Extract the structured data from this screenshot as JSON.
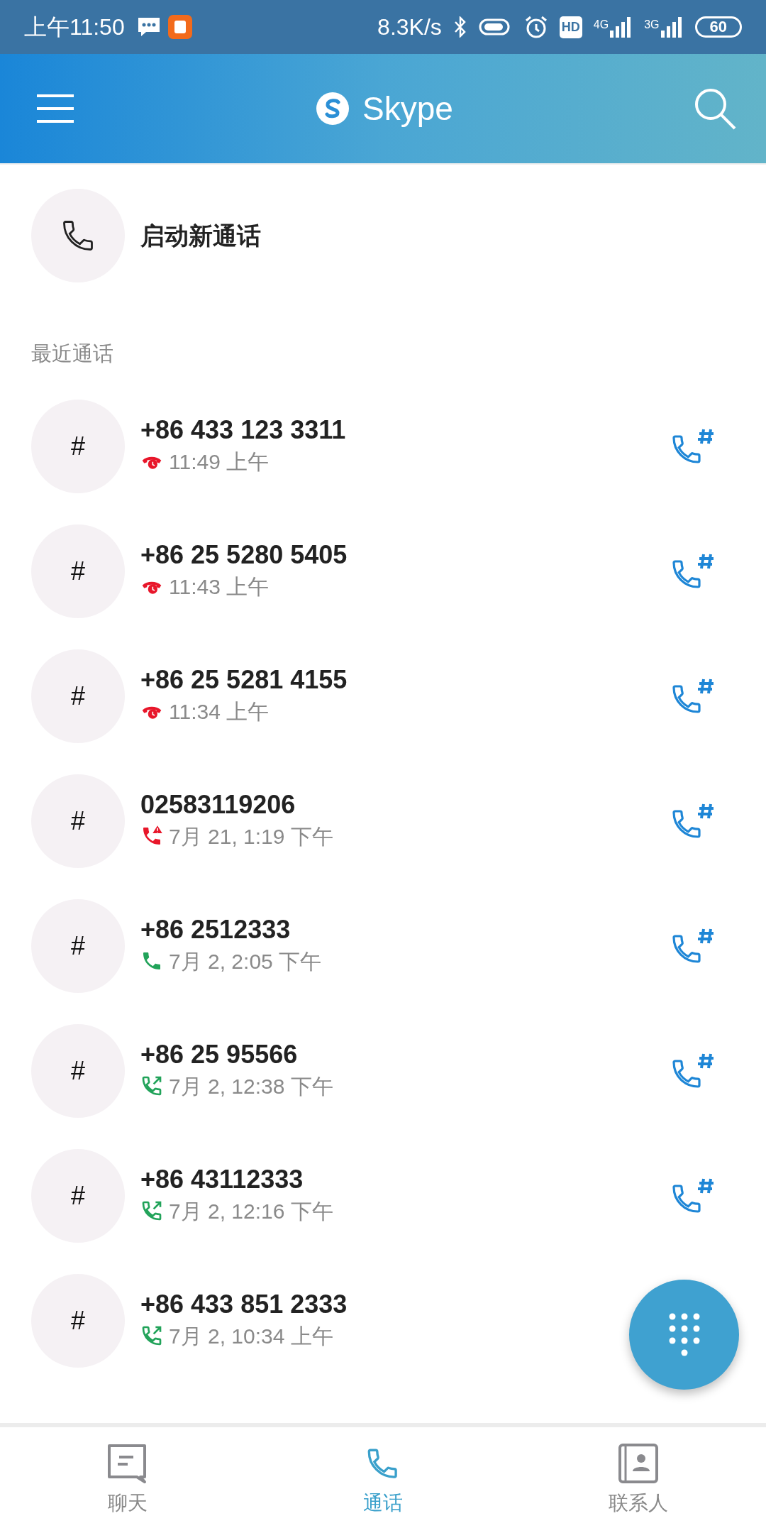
{
  "status_bar": {
    "time": "上午11:50",
    "speed": "8.3K/s",
    "hd": "HD",
    "net1": "4G",
    "net2": "3G",
    "battery": "60"
  },
  "header": {
    "title": "Skype"
  },
  "new_call": {
    "label": "启动新通话"
  },
  "section": "最近通话",
  "calls": [
    {
      "avatar": "#",
      "number": "+86 433 123 3311",
      "kind": "missed",
      "time": "11:49 上午"
    },
    {
      "avatar": "#",
      "number": "+86 25 5280 5405",
      "kind": "missed",
      "time": "11:43 上午"
    },
    {
      "avatar": "#",
      "number": "+86 25 5281 4155",
      "kind": "missed",
      "time": "11:34 上午"
    },
    {
      "avatar": "#",
      "number": "02583119206",
      "kind": "failed",
      "time": "7月 21, 1:19 下午"
    },
    {
      "avatar": "#",
      "number": "+86 2512333",
      "kind": "incoming",
      "time": "7月 2, 2:05 下午"
    },
    {
      "avatar": "#",
      "number": "+86 25 95566",
      "kind": "outgoing",
      "time": "7月 2, 12:38 下午"
    },
    {
      "avatar": "#",
      "number": "+86 43112333",
      "kind": "outgoing",
      "time": "7月 2, 12:16 下午"
    },
    {
      "avatar": "#",
      "number": "+86 433 851 2333",
      "kind": "outgoing",
      "time": "7月 2, 10:34 上午",
      "dialpad": false
    }
  ],
  "tabs": [
    {
      "label": "聊天",
      "kind": "chat",
      "selected": false
    },
    {
      "label": "通话",
      "kind": "calls",
      "selected": true
    },
    {
      "label": "联系人",
      "kind": "contacts",
      "selected": false
    }
  ]
}
